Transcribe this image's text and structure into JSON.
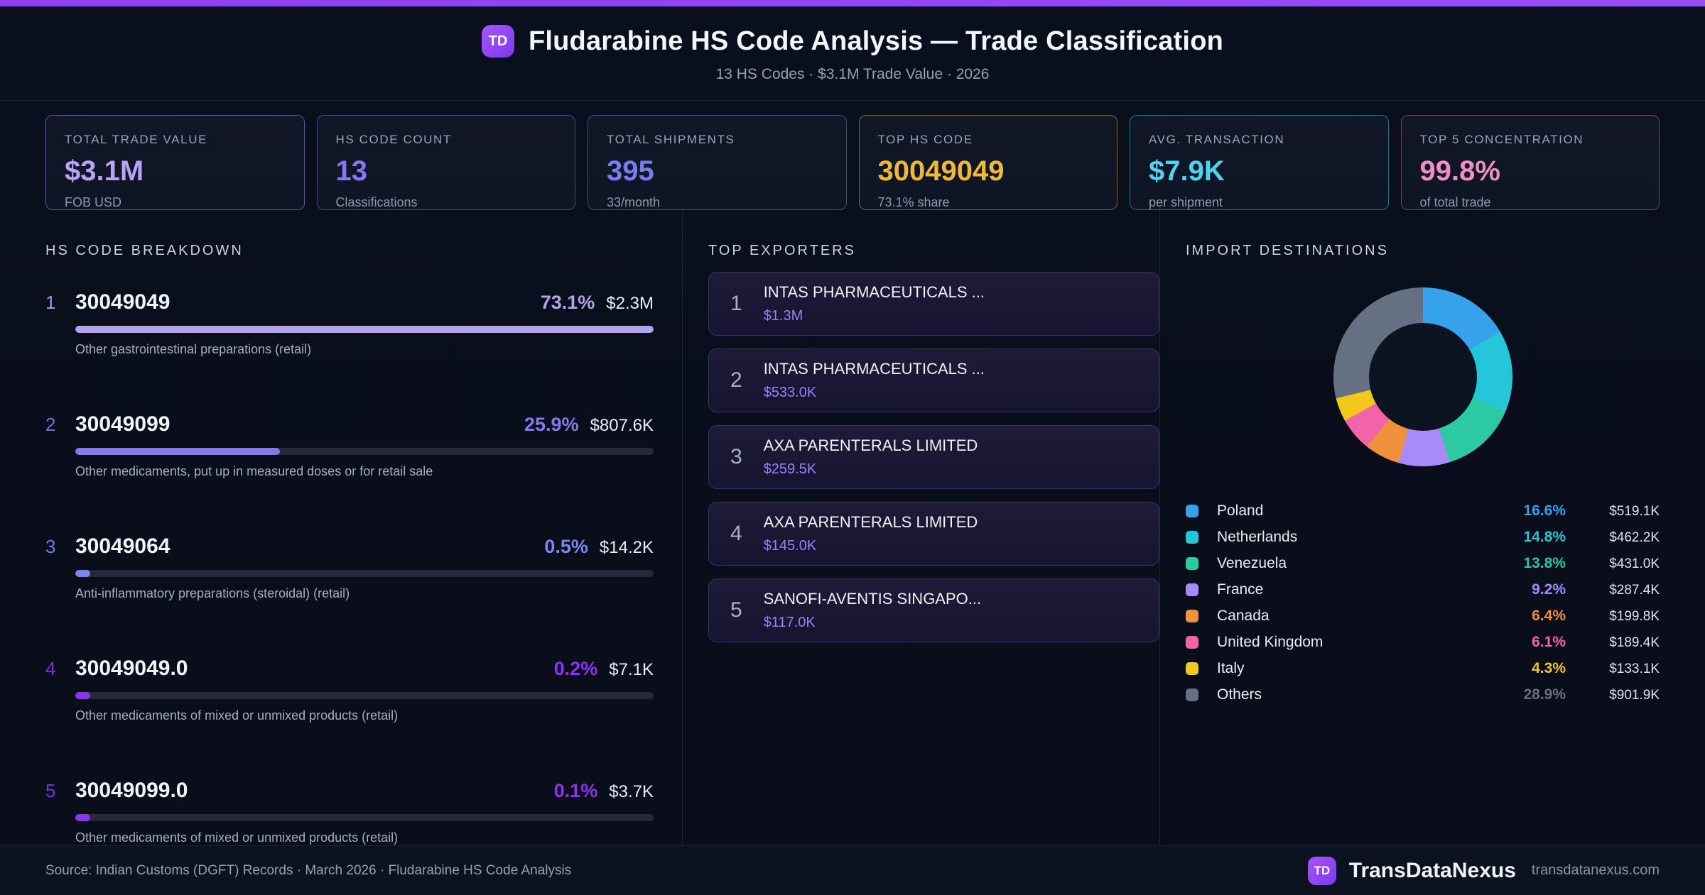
{
  "header": {
    "badge": "TD",
    "title": "Fludarabine HS Code Analysis — Trade Classification",
    "subtitle": "13 HS Codes · $3.1M Trade Value · 2026"
  },
  "stats": [
    {
      "label": "TOTAL TRADE VALUE",
      "value": "$3.1M",
      "sub": "FOB USD",
      "color": "#b7a4f4",
      "border": "rgba(167,139,250,0.55)"
    },
    {
      "label": "HS CODE COUNT",
      "value": "13",
      "sub": "Classifications",
      "color": "#8b76f2",
      "border": "rgba(139,118,242,0.5)"
    },
    {
      "label": "TOTAL SHIPMENTS",
      "value": "395",
      "sub": "33/month",
      "color": "#7a7df2",
      "border": "rgba(110,120,230,0.55)"
    },
    {
      "label": "TOP HS CODE",
      "value": "30049049",
      "sub": "73.1% share",
      "color": "#f0b73d",
      "border": "rgba(205,170,80,0.55)"
    },
    {
      "label": "AVG. TRANSACTION",
      "value": "$7.9K",
      "sub": "per shipment",
      "color": "#4ed4f0",
      "border": "rgba(60,170,195,0.6)"
    },
    {
      "label": "TOP 5 CONCENTRATION",
      "value": "99.8%",
      "sub": "of total trade",
      "color": "#f18ec3",
      "border": "rgba(190,95,140,0.6)"
    }
  ],
  "chart_data": [
    {
      "type": "bar",
      "title": "HS CODE BREAKDOWN",
      "orientation": "horizontal",
      "max_pct": 73.1,
      "note": "bar lengths scaled to top item; minimum visible stub for tiny values",
      "items": [
        {
          "rank": "1",
          "code": "30049049",
          "pct": 73.1,
          "pct_label": "73.1%",
          "value": "$2.3M",
          "desc": "Other gastrointestinal preparations (retail)",
          "color": "#b3a3ef"
        },
        {
          "rank": "2",
          "code": "30049099",
          "pct": 25.9,
          "pct_label": "25.9%",
          "value": "$807.6K",
          "desc": "Other medicaments, put up in measured doses or for retail sale",
          "color": "#8678e9"
        },
        {
          "rank": "3",
          "code": "30049064",
          "pct": 0.5,
          "pct_label": "0.5%",
          "value": "$14.2K",
          "desc": "Anti-inflammatory preparations (steroidal) (retail)",
          "color": "#7b86ee"
        },
        {
          "rank": "4",
          "code": "30049049.0",
          "pct": 0.2,
          "pct_label": "0.2%",
          "value": "$7.1K",
          "desc": "Other medicaments of mixed or unmixed products (retail)",
          "color": "#8c33f0"
        },
        {
          "rank": "5",
          "code": "30049099.0",
          "pct": 0.1,
          "pct_label": "0.1%",
          "value": "$3.7K",
          "desc": "Other medicaments of mixed or unmixed products (retail)",
          "color": "#8c33f0"
        }
      ]
    },
    {
      "type": "pie",
      "donut": true,
      "title": "IMPORT DESTINATIONS",
      "legend_position": "bottom",
      "items": [
        {
          "label": "Poland",
          "pct": 16.6,
          "pct_label": "16.6%",
          "value": "$519.1K",
          "color": "#36a2eb"
        },
        {
          "label": "Netherlands",
          "pct": 14.8,
          "pct_label": "14.8%",
          "value": "$462.2K",
          "color": "#26c6da"
        },
        {
          "label": "Venezuela",
          "pct": 13.8,
          "pct_label": "13.8%",
          "value": "$431.0K",
          "color": "#2dc9a3"
        },
        {
          "label": "France",
          "pct": 9.2,
          "pct_label": "9.2%",
          "value": "$287.4K",
          "color": "#a78bfa"
        },
        {
          "label": "Canada",
          "pct": 6.4,
          "pct_label": "6.4%",
          "value": "$199.8K",
          "color": "#f0913c"
        },
        {
          "label": "United Kingdom",
          "pct": 6.1,
          "pct_label": "6.1%",
          "value": "$189.4K",
          "color": "#f164a8"
        },
        {
          "label": "Italy",
          "pct": 4.3,
          "pct_label": "4.3%",
          "value": "$133.1K",
          "color": "#f3c81d"
        },
        {
          "label": "Others",
          "pct": 28.9,
          "pct_label": "28.9%",
          "value": "$901.9K",
          "color": "#657083"
        }
      ]
    }
  ],
  "exporters": {
    "title": "TOP EXPORTERS",
    "items": [
      {
        "rank": "1",
        "name": "INTAS PHARMACEUTICALS ...",
        "value": "$1.3M"
      },
      {
        "rank": "2",
        "name": "INTAS PHARMACEUTICALS ...",
        "value": "$533.0K"
      },
      {
        "rank": "3",
        "name": "AXA PARENTERALS LIMITED",
        "value": "$259.5K"
      },
      {
        "rank": "4",
        "name": "AXA PARENTERALS LIMITED",
        "value": "$145.0K"
      },
      {
        "rank": "5",
        "name": "SANOFI-AVENTIS SINGAPO...",
        "value": "$117.0K"
      }
    ]
  },
  "footer": {
    "source": "Source: Indian Customs (DGFT) Records · March 2026 · Fludarabine HS Code Analysis",
    "badge": "TD",
    "brand": "TransDataNexus",
    "domain": "transdatanexus.com"
  }
}
